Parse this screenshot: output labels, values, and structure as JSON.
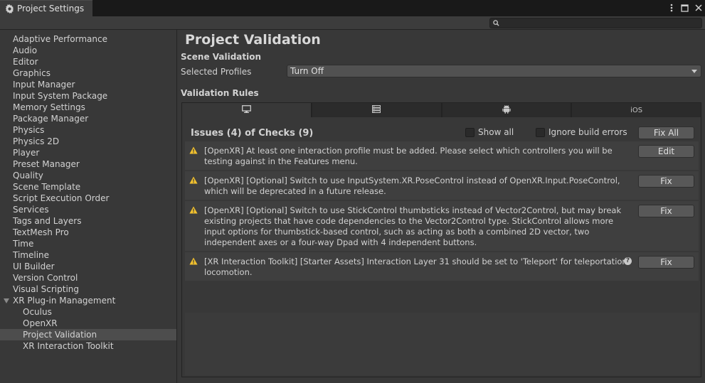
{
  "window": {
    "tab_title": "Project Settings",
    "tab_icon": "gear-icon"
  },
  "search": {
    "placeholder": "",
    "value": ""
  },
  "sidebar": {
    "items": [
      {
        "label": "Adaptive Performance"
      },
      {
        "label": "Audio"
      },
      {
        "label": "Editor"
      },
      {
        "label": "Graphics"
      },
      {
        "label": "Input Manager"
      },
      {
        "label": "Input System Package"
      },
      {
        "label": "Memory Settings"
      },
      {
        "label": "Package Manager"
      },
      {
        "label": "Physics"
      },
      {
        "label": "Physics 2D"
      },
      {
        "label": "Player"
      },
      {
        "label": "Preset Manager"
      },
      {
        "label": "Quality"
      },
      {
        "label": "Scene Template"
      },
      {
        "label": "Script Execution Order"
      },
      {
        "label": "Services"
      },
      {
        "label": "Tags and Layers"
      },
      {
        "label": "TextMesh Pro"
      },
      {
        "label": "Time"
      },
      {
        "label": "Timeline"
      },
      {
        "label": "UI Builder"
      },
      {
        "label": "Version Control"
      },
      {
        "label": "Visual Scripting"
      },
      {
        "label": "XR Plug-in Management"
      },
      {
        "label": "Oculus"
      },
      {
        "label": "OpenXR"
      },
      {
        "label": "Project Validation"
      },
      {
        "label": "XR Interaction Toolkit"
      }
    ],
    "selected": "Project Validation"
  },
  "main": {
    "title": "Project Validation",
    "scene_validation_label": "Scene Validation",
    "selected_profiles_label": "Selected Profiles",
    "selected_profiles_value": "Turn Off",
    "validation_rules_label": "Validation Rules",
    "platform_tabs": [
      {
        "icon": "monitor-icon",
        "label": ""
      },
      {
        "icon": "server-icon",
        "label": ""
      },
      {
        "icon": "android-icon",
        "label": ""
      },
      {
        "icon": "",
        "label": "iOS"
      }
    ],
    "issues_header": "Issues (4) of Checks (9)",
    "show_all_label": "Show all",
    "ignore_build_errors_label": "Ignore build errors",
    "fix_all_label": "Fix All",
    "issues": [
      {
        "line1": "[OpenXR] At least one interaction profile must be added.  Please select which controllers you will be",
        "line2": "testing against in the Features menu.",
        "line3": "",
        "line4": "",
        "button": "Edit",
        "has_help": false
      },
      {
        "line1": "[OpenXR] [Optional] Switch to use InputSystem.XR.PoseControl instead of OpenXR.Input.PoseControl,",
        "line2": "which will be deprecated in a future release.",
        "line3": "",
        "line4": "",
        "button": "Fix",
        "has_help": false
      },
      {
        "line1": "[OpenXR] [Optional] Switch to use StickControl thumbsticks instead of Vector2Control, but may break",
        "line2": "existing projects that have code dependencies to the Vector2Control type. StickControl allows more",
        "line3": "input options for thumbstick-based control, such as acting as both a combined 2D vector, two",
        "line4": "independent axes or a four-way Dpad with 4 independent buttons.",
        "button": "Fix",
        "has_help": false
      },
      {
        "line1": "[XR Interaction Toolkit] [Starter Assets] Interaction Layer 31 should be set to 'Teleport' for teleportation",
        "line2": "locomotion.",
        "line3": "",
        "line4": "",
        "button": "Fix",
        "has_help": true,
        "help_glyph": "?"
      }
    ]
  },
  "colors": {
    "background": "#383838",
    "titlebar": "#191919",
    "selected_item": "#4d4d4d",
    "warning": "#f2c12e"
  }
}
